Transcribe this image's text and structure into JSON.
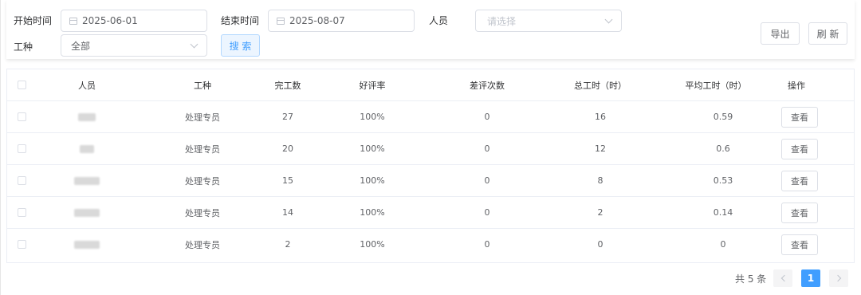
{
  "filters": {
    "start_label": "开始时间",
    "start_value": "2025-06-01",
    "end_label": "结束时间",
    "end_value": "2025-08-07",
    "person_label": "人员",
    "person_placeholder": "请选择",
    "worktype_label": "工种",
    "worktype_value": "全部",
    "search_button": "搜 索"
  },
  "actions": {
    "export_button": "导出",
    "refresh_button": "刷 新"
  },
  "table": {
    "headers": [
      "人员",
      "工种",
      "完工数",
      "好评率",
      "差评次数",
      "总工时（时）",
      "平均工时（时）",
      "操作"
    ],
    "rows": [
      {
        "worktype": "处理专员",
        "completed": "27",
        "good_rate": "100%",
        "bad_count": "0",
        "total_hours": "16",
        "avg_hours": "0.59",
        "action": "查看"
      },
      {
        "worktype": "处理专员",
        "completed": "20",
        "good_rate": "100%",
        "bad_count": "0",
        "total_hours": "12",
        "avg_hours": "0.6",
        "action": "查看"
      },
      {
        "worktype": "处理专员",
        "completed": "15",
        "good_rate": "100%",
        "bad_count": "0",
        "total_hours": "8",
        "avg_hours": "0.53",
        "action": "查看"
      },
      {
        "worktype": "处理专员",
        "completed": "14",
        "good_rate": "100%",
        "bad_count": "0",
        "total_hours": "2",
        "avg_hours": "0.14",
        "action": "查看"
      },
      {
        "worktype": "处理专员",
        "completed": "2",
        "good_rate": "100%",
        "bad_count": "0",
        "total_hours": "0",
        "avg_hours": "0",
        "action": "查看"
      }
    ]
  },
  "pagination": {
    "total": "共 5 条",
    "current_page": "1"
  },
  "icons": {
    "date": "calendar-icon",
    "select": "chevron-down-icon",
    "prev": "chevron-left-icon",
    "next": "chevron-right-icon"
  },
  "colors": {
    "primary": "#409eff",
    "border": "#dcdfe6"
  }
}
